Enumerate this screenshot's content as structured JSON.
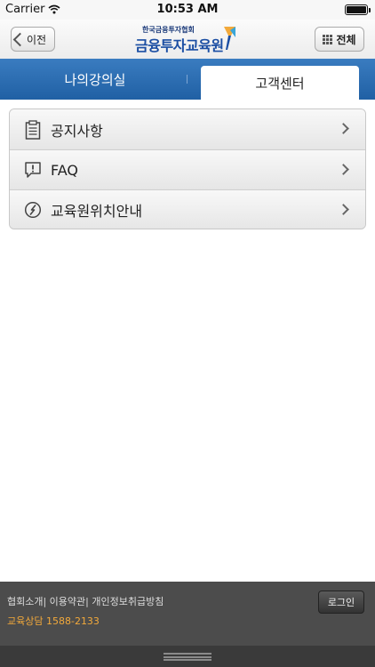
{
  "status_bar": {
    "carrier": "Carrier",
    "time": "10:53 AM"
  },
  "nav": {
    "back_label": "이전",
    "logo_sub": "한국금융투자협회",
    "logo_main": "금융투자교육원",
    "all_menu_label": "전체"
  },
  "tabs": [
    {
      "label": "나의강의실",
      "selected": false
    },
    {
      "label": "고객센터",
      "selected": true
    }
  ],
  "menu": {
    "items": [
      {
        "label": "공지사항",
        "icon": "clipboard-icon"
      },
      {
        "label": "FAQ",
        "icon": "speech-exclamation-icon"
      },
      {
        "label": "교육원위치안내",
        "icon": "compass-icon"
      }
    ]
  },
  "footer": {
    "links": "협회소개| 이용약관| 개인정보취급방침",
    "phone": "교육상담 1588-2133",
    "login_label": "로그인"
  },
  "colors": {
    "tab_bar": "#2a6cb2",
    "footer_bg": "#4c4c4c",
    "phone_text": "#f2a93b",
    "logo_blue": "#1b4ea3"
  }
}
